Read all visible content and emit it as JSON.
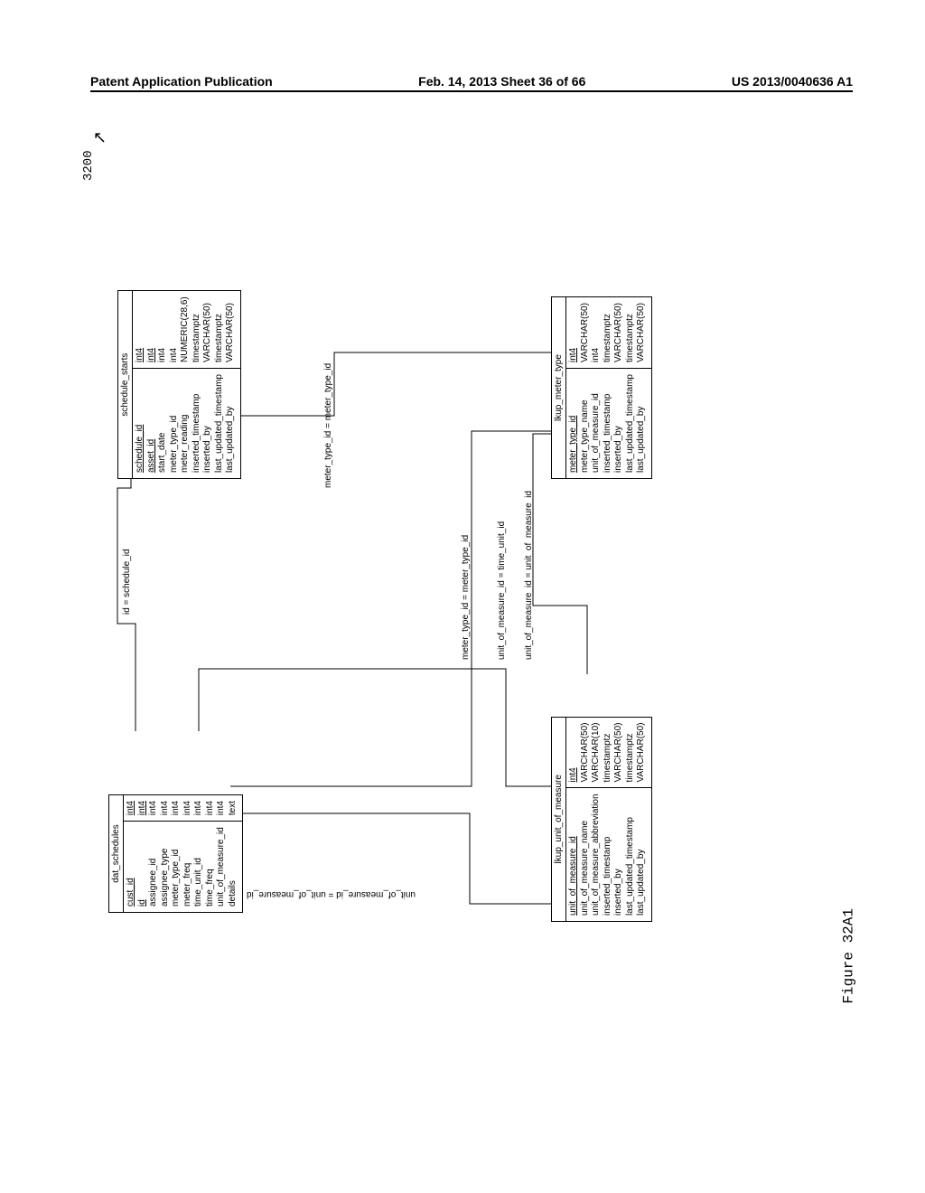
{
  "header": {
    "left": "Patent Application Publication",
    "center": "Feb. 14, 2013  Sheet 36 of 66",
    "right": "US 2013/0040636 A1"
  },
  "ref_number": "3200",
  "figure_caption": "Figure 32A1",
  "entities": {
    "dat_schedules": {
      "title": "dat_schedules",
      "rows": [
        {
          "name": "cust_id",
          "type": "int4",
          "ul": true
        },
        {
          "name": "id",
          "type": "int4",
          "ul": true
        },
        {
          "name": "assignee_id",
          "type": "int4",
          "ul": false
        },
        {
          "name": "assignee_type",
          "type": "int4",
          "ul": false
        },
        {
          "name": "meter_type_id",
          "type": "int4",
          "ul": false
        },
        {
          "name": "meter_freq",
          "type": "int4",
          "ul": false
        },
        {
          "name": "time_unit_id",
          "type": "int4",
          "ul": false
        },
        {
          "name": "time_freq",
          "type": "int4",
          "ul": false
        },
        {
          "name": "unit_of_measure_id",
          "type": "int4",
          "ul": false
        },
        {
          "name": "details",
          "type": "text",
          "ul": false
        }
      ]
    },
    "schedule_starts": {
      "title": "schedule_starts",
      "rows": [
        {
          "name": "schedule_id",
          "type": "int4",
          "ul": true
        },
        {
          "name": "asset_id",
          "type": "int4",
          "ul": true
        },
        {
          "name": "start_date",
          "type": "int4",
          "ul": false
        },
        {
          "name": "meter_type_id",
          "type": "int4",
          "ul": false
        },
        {
          "name": "meter_reading",
          "type": "NUMERIC(28,6)",
          "ul": false
        },
        {
          "name": "inserted_timestamp",
          "type": "timestamptz",
          "ul": false
        },
        {
          "name": "inserted_by",
          "type": "VARCHAR(50)",
          "ul": false
        },
        {
          "name": "last_updated_timestamp",
          "type": "timestamptz",
          "ul": false
        },
        {
          "name": "last_updated_by",
          "type": "VARCHAR(50)",
          "ul": false
        }
      ]
    },
    "lkup_unit_of_measure": {
      "title": "lkup_unit_of_measure",
      "rows": [
        {
          "name": "unit_of_measure_id",
          "type": "int4",
          "ul": true
        },
        {
          "name": "unit_of_measure_name",
          "type": "VARCHAR(50)",
          "ul": false
        },
        {
          "name": "unit_of_measure_abbreviation",
          "type": "VARCHAR(10)",
          "ul": false
        },
        {
          "name": "inserted_timestamp",
          "type": "timestamptz",
          "ul": false
        },
        {
          "name": "inserted_by",
          "type": "VARCHAR(50)",
          "ul": false
        },
        {
          "name": "last_updated_timestamp",
          "type": "timestamptz",
          "ul": false
        },
        {
          "name": "last_updated_by",
          "type": "VARCHAR(50)",
          "ul": false
        }
      ]
    },
    "lkup_meter_type": {
      "title": "lkup_meter_type",
      "rows": [
        {
          "name": "meter_type_id",
          "type": "int4",
          "ul": true
        },
        {
          "name": "meter_type_name",
          "type": "VARCHAR(50)",
          "ul": false
        },
        {
          "name": "unit_of_measure_id",
          "type": "int4",
          "ul": false
        },
        {
          "name": "inserted_timestamp",
          "type": "timestamptz",
          "ul": false
        },
        {
          "name": "inserted_by",
          "type": "VARCHAR(50)",
          "ul": false
        },
        {
          "name": "last_updated_timestamp",
          "type": "timestamptz",
          "ul": false
        },
        {
          "name": "last_updated_by",
          "type": "VARCHAR(50)",
          "ul": false
        }
      ]
    }
  },
  "relations": {
    "r1": "id = schedule_id",
    "r2": "unit_of_measure_id = unit_of_measure_id",
    "r3": "meter_type_id = meter_type_id",
    "r4": "unit_of_measure_id = time_unit_id",
    "r5": "unit_of_measure_id = unit_of_measure_id",
    "r6": "meter_type_id = meter_type_id"
  }
}
